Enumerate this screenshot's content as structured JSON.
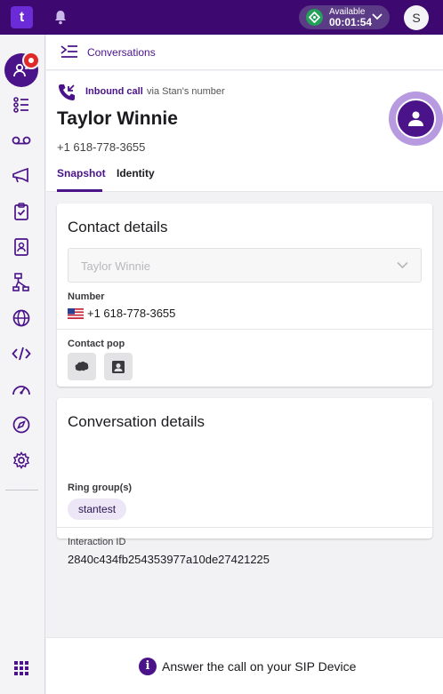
{
  "topbar": {
    "logo_text": "t",
    "status_label": "Available",
    "status_timer": "00:01:54",
    "avatar_initial": "S"
  },
  "breadcrumb": {
    "label": "Conversations"
  },
  "call": {
    "type_label": "Inbound call",
    "via_label": "via Stan's number",
    "caller_name": "Taylor Winnie",
    "caller_number": "+1 618-778-3655"
  },
  "tabs": [
    {
      "label": "Snapshot",
      "active": true
    },
    {
      "label": "Identity",
      "active": false
    }
  ],
  "contact_details": {
    "title": "Contact details",
    "select_value": "Taylor Winnie",
    "number_label": "Number",
    "number_value": "+1 618-778-3655",
    "contact_pop_label": "Contact pop"
  },
  "conversation_details": {
    "title": "Conversation details",
    "ring_groups_label": "Ring group(s)",
    "ring_group_chip": "stantest",
    "interaction_id_label": "Interaction ID",
    "interaction_id_value": "2840c434fb254353977a10de27421225"
  },
  "bottom_bar": {
    "info_icon_glyph": "i",
    "message": "Answer the call on your SIP Device"
  },
  "icons": {
    "sidebar": [
      "conversations-icon",
      "queue-list-icon",
      "voicemail-icon",
      "megaphone-icon",
      "clipboard-check-icon",
      "contacts-book-icon",
      "routing-icon",
      "globe-icon",
      "code-icon",
      "speedometer-icon",
      "compass-icon",
      "gear-icon",
      "apps-grid-icon"
    ]
  },
  "colors": {
    "brand_dark": "#3d0870",
    "brand_primary": "#4a1389",
    "available_green": "#23a05a",
    "badge_red": "#e02a2a",
    "chip_bg": "#ece6f6"
  }
}
